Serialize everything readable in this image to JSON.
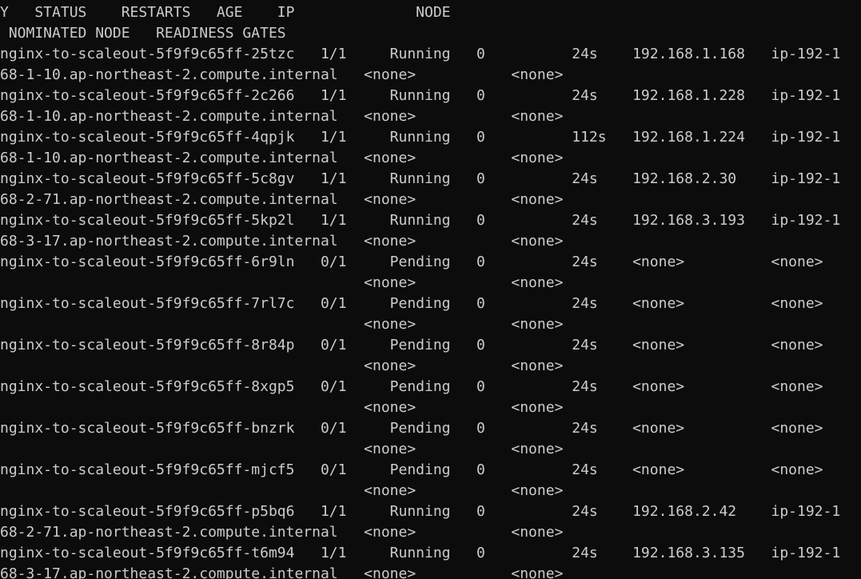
{
  "terminal": {
    "lines": [
      "Y   STATUS    RESTARTS   AGE    IP              NODE",
      " NOMINATED NODE   READINESS GATES",
      "nginx-to-scaleout-5f9f9c65ff-25tzc   1/1     Running   0          24s    192.168.1.168   ip-192-1",
      "68-1-10.ap-northeast-2.compute.internal   <none>           <none>",
      "nginx-to-scaleout-5f9f9c65ff-2c266   1/1     Running   0          24s    192.168.1.228   ip-192-1",
      "68-1-10.ap-northeast-2.compute.internal   <none>           <none>",
      "nginx-to-scaleout-5f9f9c65ff-4qpjk   1/1     Running   0          112s   192.168.1.224   ip-192-1",
      "68-1-10.ap-northeast-2.compute.internal   <none>           <none>",
      "nginx-to-scaleout-5f9f9c65ff-5c8gv   1/1     Running   0          24s    192.168.2.30    ip-192-1",
      "68-2-71.ap-northeast-2.compute.internal   <none>           <none>",
      "nginx-to-scaleout-5f9f9c65ff-5kp2l   1/1     Running   0          24s    192.168.3.193   ip-192-1",
      "68-3-17.ap-northeast-2.compute.internal   <none>           <none>",
      "nginx-to-scaleout-5f9f9c65ff-6r9ln   0/1     Pending   0          24s    <none>          <none>",
      "                                          <none>           <none>",
      "nginx-to-scaleout-5f9f9c65ff-7rl7c   0/1     Pending   0          24s    <none>          <none>",
      "                                          <none>           <none>",
      "nginx-to-scaleout-5f9f9c65ff-8r84p   0/1     Pending   0          24s    <none>          <none>",
      "                                          <none>           <none>",
      "nginx-to-scaleout-5f9f9c65ff-8xgp5   0/1     Pending   0          24s    <none>          <none>",
      "                                          <none>           <none>",
      "nginx-to-scaleout-5f9f9c65ff-bnzrk   0/1     Pending   0          24s    <none>          <none>",
      "                                          <none>           <none>",
      "nginx-to-scaleout-5f9f9c65ff-mjcf5   0/1     Pending   0          24s    <none>          <none>",
      "                                          <none>           <none>",
      "nginx-to-scaleout-5f9f9c65ff-p5bq6   1/1     Running   0          24s    192.168.2.42    ip-192-1",
      "68-2-71.ap-northeast-2.compute.internal   <none>           <none>",
      "nginx-to-scaleout-5f9f9c65ff-t6m94   1/1     Running   0          24s    192.168.3.135   ip-192-1",
      "68-3-17.ap-northeast-2.compute.internal   <none>           <none>"
    ]
  }
}
